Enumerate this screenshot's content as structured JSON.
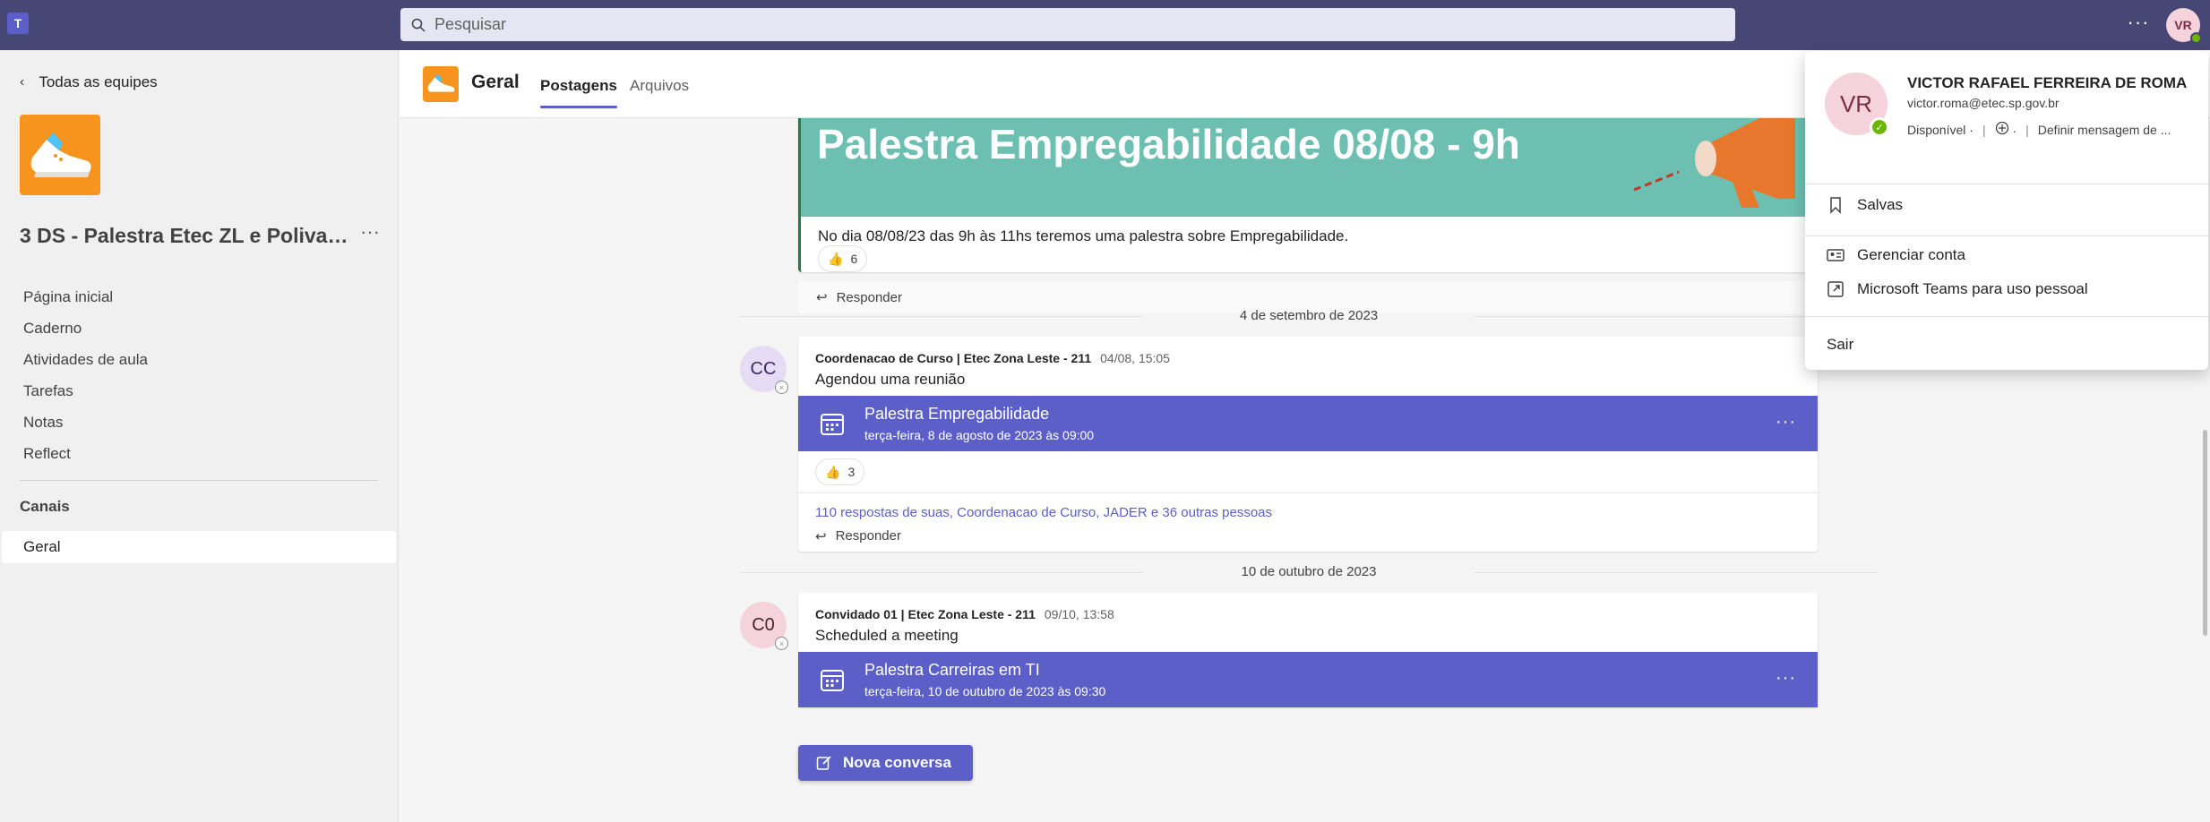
{
  "topbar": {
    "app_icon": "teams-icon",
    "search_placeholder": "Pesquisar",
    "more_icon": "more-horizontal-icon",
    "avatar_initials": "VR"
  },
  "sidebar": {
    "back_label": "Todas as equipes",
    "team_name": "3 DS - Palestra Etec ZL e Polivale...",
    "nav_items": [
      {
        "label": "Página inicial"
      },
      {
        "label": "Caderno"
      },
      {
        "label": "Atividades de aula"
      },
      {
        "label": "Tarefas"
      },
      {
        "label": "Notas"
      },
      {
        "label": "Reflect"
      }
    ],
    "channels_title": "Canais",
    "channels": [
      {
        "label": "Geral"
      }
    ]
  },
  "header": {
    "channel_title": "Geral",
    "tabs": [
      {
        "label": "Postagens"
      },
      {
        "label": "Arquivos"
      }
    ]
  },
  "feed": {
    "post1": {
      "banner_title": "Palestra Empregabilidade 08/08 - 9h",
      "text": "No dia 08/08/23 das 9h às 11hs teremos uma palestra sobre Empregabilidade.",
      "reaction_count": "6",
      "reply_label": "Responder"
    },
    "date_sep_1": "4 de setembro de 2023",
    "post2": {
      "avatar_initials": "CC",
      "author": "Coordenacao de Curso | Etec Zona Leste - 211",
      "time": "04/08, 15:05",
      "body": "Agendou uma reunião",
      "meeting_title": "Palestra Empregabilidade",
      "meeting_date": "terça-feira, 8 de agosto de 2023 às 09:00",
      "reaction_count": "3",
      "replies_summary": "110 respostas de suas, Coordenacao de Curso, JADER e 36 outras pessoas",
      "reply_label": "Responder"
    },
    "date_sep_2": "10 de outubro de 2023",
    "post3": {
      "avatar_initials": "C0",
      "author": "Convidado 01 | Etec Zona Leste - 211",
      "time": "09/10, 13:58",
      "body": "Scheduled a meeting",
      "meeting_title": "Palestra Carreiras em TI",
      "meeting_date": "terça-feira, 10 de outubro de 2023 às 09:30"
    },
    "new_conversation_label": "Nova conversa"
  },
  "profile_popup": {
    "initials": "VR",
    "name": "VICTOR RAFAEL FERREIRA DE ROMA",
    "email": "victor.roma@etec.sp.gov.br",
    "status": "Disponível",
    "set_message": "Definir mensagem de ...",
    "items": [
      {
        "label": "Salvas",
        "icon": "bookmark-icon"
      },
      {
        "label": "Gerenciar conta",
        "icon": "contact-card-icon"
      },
      {
        "label": "Microsoft Teams para uso pessoal",
        "icon": "open-external-icon"
      },
      {
        "label": "Sair",
        "icon": ""
      }
    ]
  },
  "colors": {
    "topbar": "#464775",
    "brand": "#5b5fc7",
    "banner": "#6dc0b1",
    "team_logo": "#f7941d",
    "presence": "#6bb700"
  }
}
